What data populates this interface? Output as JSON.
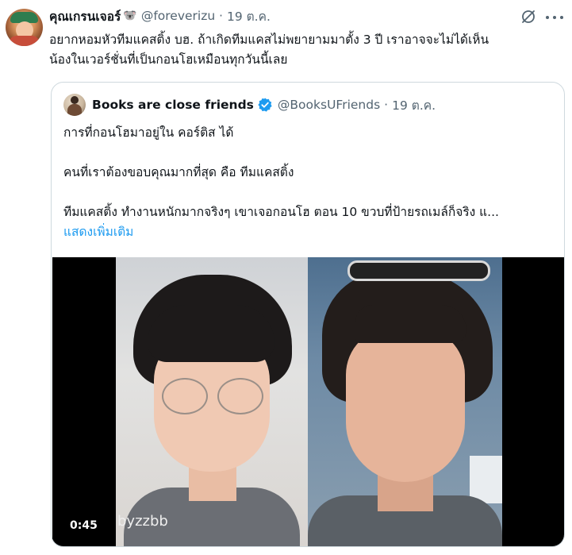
{
  "tweet": {
    "author": {
      "display_name": "คุณเกรนเจอร์",
      "name_emoji": "🐨",
      "handle": "@foreverizu",
      "time": "19 ต.ค."
    },
    "text_lines": [
      "อยากหอมหัวทีมแคสติ้ง บฮ. ถ้าเกิดทีมแคสไม่พยายามมาตั้ง 3 ปี เราอาจจะไม่ได้เห็น",
      "น้องในเวอร์ชั่นที่เป็นกอนโฮเหมือนทุกวันนี้เลย"
    ],
    "icons": {
      "grok": "grok-icon",
      "more": "more-icon"
    }
  },
  "quote": {
    "author": {
      "display_name": "Books are close friends",
      "handle": "@BooksUFriends",
      "time": "19 ต.ค.",
      "verified_icon": "verified-badge-icon"
    },
    "text": {
      "line1": "การที่กอนโฮมาอยู่ใน คอร์ติส ได้",
      "line2": "คนที่เราต้องขอบคุณมากที่สุด คือ ทีมแคสติ้ง",
      "line3": "ทีมแคสติ้ง ทำงานหนักมากจริงๆ เขาเจอกอนโฮ ตอน 10 ขวบที่ป้ายรถเมล์ก็จริง แ...",
      "show_more": "แสดงเพิ่มเติม"
    },
    "media": {
      "watermark": "byzzbb",
      "duration": "0:45"
    }
  },
  "colors": {
    "link": "#1d9bf0",
    "secondary_text": "#536471",
    "border": "#cfd9de"
  }
}
